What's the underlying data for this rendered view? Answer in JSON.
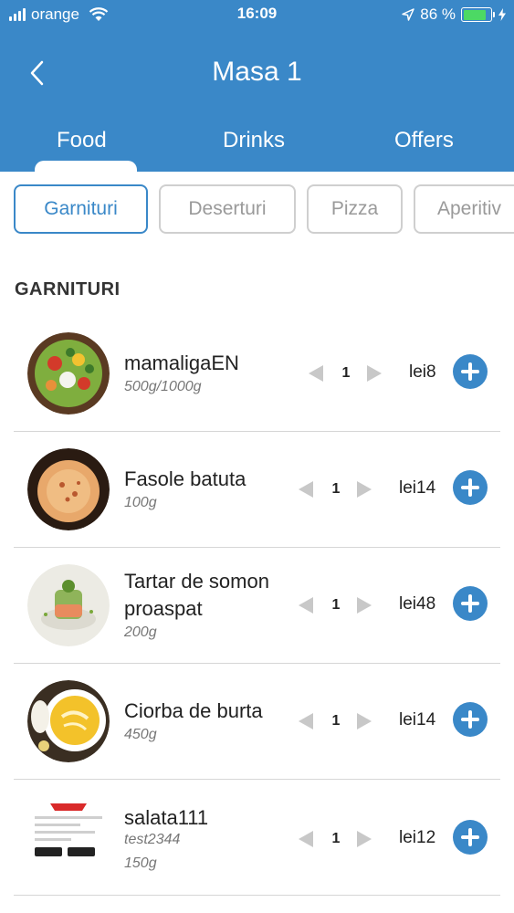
{
  "status_bar": {
    "carrier": "orange",
    "time": "16:09",
    "battery": "86 %",
    "battery_level": 0.86
  },
  "header": {
    "title": "Masa 1"
  },
  "tabs": [
    {
      "label": "Food",
      "active": true
    },
    {
      "label": "Drinks",
      "active": false
    },
    {
      "label": "Offers",
      "active": false
    }
  ],
  "categories": [
    {
      "label": "Garnituri",
      "active": true
    },
    {
      "label": "Deserturi",
      "active": false
    },
    {
      "label": "Pizza",
      "active": false
    },
    {
      "label": "Aperitiv",
      "active": false
    }
  ],
  "section_title": "GARNITURI",
  "items": [
    {
      "name": "mamaligaEN",
      "description": "",
      "weight": "500g/1000g",
      "qty": "1",
      "price": "lei8"
    },
    {
      "name": "Fasole batuta",
      "description": "",
      "weight": "100g",
      "qty": "1",
      "price": "lei14"
    },
    {
      "name": "Tartar de somon proaspat",
      "description": "",
      "weight": "200g",
      "qty": "1",
      "price": "lei48"
    },
    {
      "name": "Ciorba de burta",
      "description": "",
      "weight": "450g",
      "qty": "1",
      "price": "lei14"
    },
    {
      "name": "salata111",
      "description": "test2344",
      "weight": "150g",
      "qty": "1",
      "price": "lei12"
    }
  ],
  "colors": {
    "primary": "#3a88c8",
    "battery": "#4cd964"
  }
}
